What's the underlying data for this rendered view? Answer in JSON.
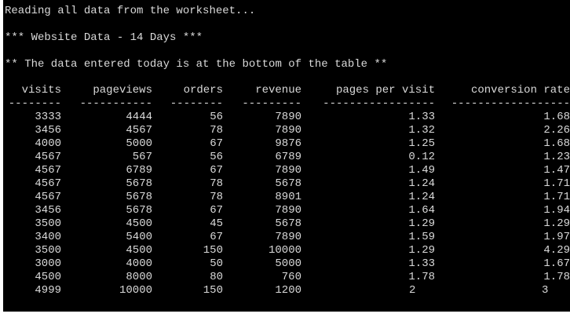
{
  "terminal": {
    "lines": [
      "Reading all data from the worksheet...",
      "*** Website Data - 14 Days ***",
      "** The data entered today is at the bottom of the table **"
    ]
  },
  "table": {
    "headers": [
      "visits",
      "pageviews",
      "orders",
      "revenue",
      "pages per visit",
      "conversion rate"
    ],
    "dashes": [
      "--------",
      "-----------",
      "--------",
      "---------",
      "-----------------",
      "------------------"
    ],
    "rows": [
      [
        "3333",
        "4444",
        "56",
        "7890",
        "1.33",
        "1.68"
      ],
      [
        "3456",
        "4567",
        "78",
        "7890",
        "1.32",
        "2.26"
      ],
      [
        "4000",
        "5000",
        "67",
        "9876",
        "1.25",
        "1.68"
      ],
      [
        "4567",
        "567",
        "56",
        "6789",
        "0.12",
        "1.23"
      ],
      [
        "4567",
        "6789",
        "67",
        "7890",
        "1.49",
        "1.47"
      ],
      [
        "4567",
        "5678",
        "78",
        "5678",
        "1.24",
        "1.71"
      ],
      [
        "4567",
        "5678",
        "78",
        "8901",
        "1.24",
        "1.71"
      ],
      [
        "3456",
        "5678",
        "67",
        "7890",
        "1.64",
        "1.94"
      ],
      [
        "3500",
        "4500",
        "45",
        "5678",
        "1.29",
        "1.29"
      ],
      [
        "3400",
        "5400",
        "67",
        "7890",
        "1.59",
        "1.97"
      ],
      [
        "3500",
        "4500",
        "150",
        "10000",
        "1.29",
        "4.29"
      ],
      [
        "3000",
        "4000",
        "50",
        "5000",
        "1.33",
        "1.67"
      ],
      [
        "4500",
        "8000",
        "80",
        "760",
        "1.78",
        "1.78"
      ],
      [
        "4999",
        "10000",
        "150",
        "1200",
        "2",
        "3"
      ]
    ]
  }
}
